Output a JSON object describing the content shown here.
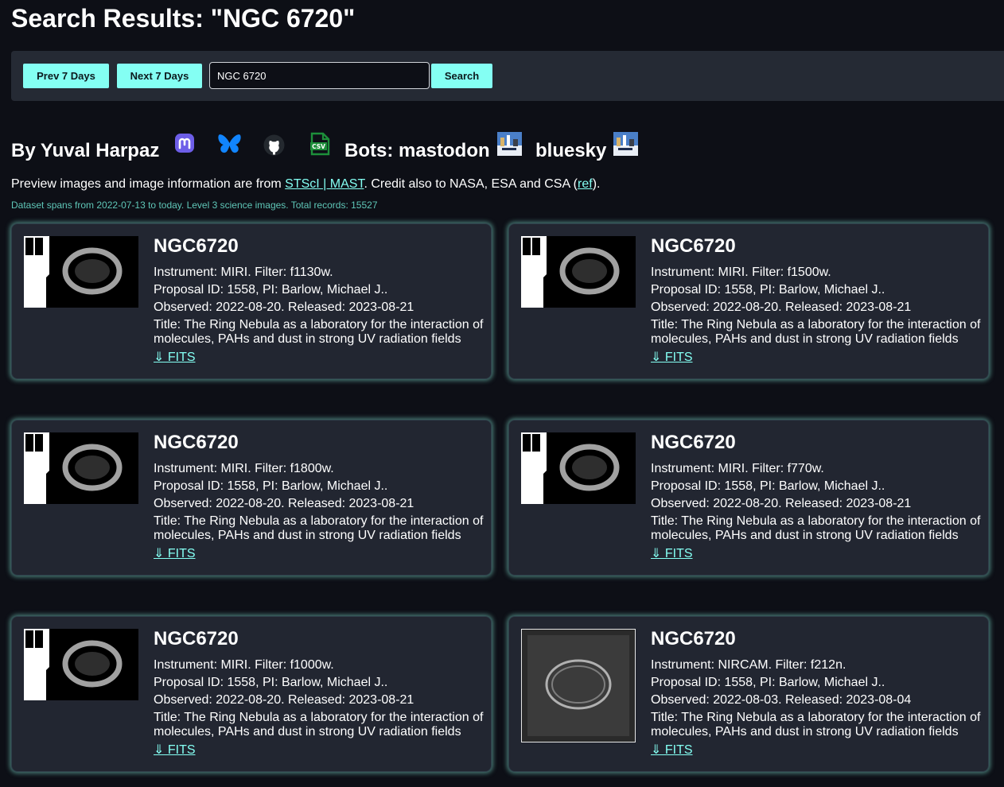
{
  "page_title": "Search Results: \"NGC 6720\"",
  "toolbar": {
    "prev_label": "Prev 7 Days",
    "next_label": "Next 7 Days",
    "search_value": "NGC 6720",
    "search_label": "Search"
  },
  "byline": {
    "author": "By Yuval Harpaz",
    "bots_label": "Bots: mastodon",
    "bluesky_label": "bluesky",
    "icons": [
      "mastodon-icon",
      "bluesky-icon",
      "github-icon",
      "csv-file-icon",
      "bot-avatar-icon"
    ]
  },
  "credits": {
    "prefix": "Preview images and image information are from ",
    "link1": "STScI | MAST",
    "middle": ". Credit also to NASA, ESA and CSA (",
    "link2": "ref",
    "suffix": ")."
  },
  "dataset_note": "Dataset spans from 2022-07-13 to today. Level 3 science images. Total records: 15527",
  "colors": {
    "background": "#0d0f16",
    "panel": "#252a34",
    "card": "#222631",
    "accent": "#84fff3",
    "glow": "#78d2c3"
  },
  "results": [
    {
      "name": "NGC6720",
      "instrument": "Instrument: MIRI. Filter: f1130w.",
      "proposal": "Proposal ID: 1558, PI: Barlow, Michael J..",
      "dates": "Observed: 2022-08-20. Released: 2023-08-21",
      "title": "Title: The Ring Nebula as a laboratory for the interaction of molecules, PAHs and dust in strong UV radiation fields",
      "link": "⇓ FITS"
    },
    {
      "name": "NGC6720",
      "instrument": "Instrument: MIRI. Filter: f1500w.",
      "proposal": "Proposal ID: 1558, PI: Barlow, Michael J..",
      "dates": "Observed: 2022-08-20. Released: 2023-08-21",
      "title": "Title: The Ring Nebula as a laboratory for the interaction of molecules, PAHs and dust in strong UV radiation fields",
      "link": "⇓ FITS"
    },
    {
      "name": "NGC6720",
      "instrument": "Instrument: MIRI. Filter: f1800w.",
      "proposal": "Proposal ID: 1558, PI: Barlow, Michael J..",
      "dates": "Observed: 2022-08-20. Released: 2023-08-21",
      "title": "Title: The Ring Nebula as a laboratory for the interaction of molecules, PAHs and dust in strong UV radiation fields",
      "link": "⇓ FITS"
    },
    {
      "name": "NGC6720",
      "instrument": "Instrument: MIRI. Filter: f770w.",
      "proposal": "Proposal ID: 1558, PI: Barlow, Michael J..",
      "dates": "Observed: 2022-08-20. Released: 2023-08-21",
      "title": "Title: The Ring Nebula as a laboratory for the interaction of molecules, PAHs and dust in strong UV radiation fields",
      "link": "⇓ FITS"
    },
    {
      "name": "NGC6720",
      "instrument": "Instrument: MIRI. Filter: f1000w.",
      "proposal": "Proposal ID: 1558, PI: Barlow, Michael J..",
      "dates": "Observed: 2022-08-20. Released: 2023-08-21",
      "title": "Title: The Ring Nebula as a laboratory for the interaction of molecules, PAHs and dust in strong UV radiation fields",
      "link": "⇓ FITS"
    },
    {
      "name": "NGC6720",
      "instrument": "Instrument: NIRCAM. Filter: f212n.",
      "proposal": "Proposal ID: 1558, PI: Barlow, Michael J..",
      "dates": "Observed: 2022-08-03. Released: 2023-08-04",
      "title": "Title: The Ring Nebula as a laboratory for the interaction of molecules, PAHs and dust in strong UV radiation fields",
      "link": "⇓ FITS"
    }
  ]
}
